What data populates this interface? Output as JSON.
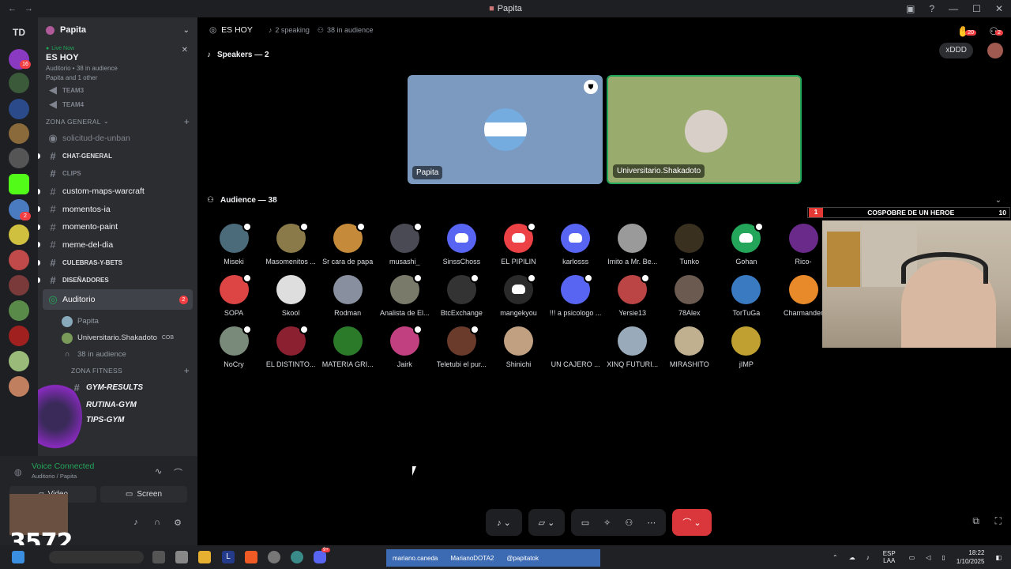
{
  "window": {
    "title": "Papita",
    "nav_back": "←",
    "nav_fwd": "→"
  },
  "servers": {
    "top_label": "TD",
    "badges": [
      "16",
      "2"
    ]
  },
  "guild": {
    "name": "Papita",
    "live": {
      "tag": "Live Now",
      "stage_name": "ES HOY",
      "meta": "Auditorio • 38 in audience",
      "people": "Papita and 1 other"
    },
    "channels_top": [
      "TEAM3",
      "TEAM4"
    ],
    "category_general": "ZONA GENERAL",
    "channels": [
      {
        "label": "solicitud-de-unban",
        "style": "muted"
      },
      {
        "label": "CHAT-GENERAL",
        "style": "small"
      },
      {
        "label": "CLIPS",
        "style": "small-muted"
      },
      {
        "label": "custom-maps-warcraft",
        "style": "normal"
      },
      {
        "label": "momentos-ia",
        "style": "normal"
      },
      {
        "label": "momento-paint",
        "style": "normal"
      },
      {
        "label": "meme-del-dia",
        "style": "normal"
      },
      {
        "label": "CULEBRAS-Y-BETS",
        "style": "small"
      },
      {
        "label": "DISEÑADORES",
        "style": "small"
      }
    ],
    "stage_channel": {
      "label": "Auditorio",
      "badge": "2"
    },
    "stage_users": [
      {
        "name": "Papita",
        "tag": ""
      },
      {
        "name": "Universitario.Shakadoto",
        "tag": "COB"
      }
    ],
    "stage_audience": "38 in audience",
    "category_fitness": "ZONA FITNESS",
    "fitness_channels": [
      "GYM-RESULTS",
      "RUTINA-GYM",
      "TIPS-GYM"
    ]
  },
  "user_panel": {
    "status": "Voice Connected",
    "location": "Auditorio / Papita",
    "video_label": "Video",
    "screen_label": "Screen",
    "viewer_count": "3572"
  },
  "stage": {
    "title": "ES HOY",
    "speaking": "2 speaking",
    "audience_count": "38 in audience",
    "hands_badge": "20",
    "invite_badge": "2",
    "xddd": "xDDD",
    "speakers_label": "Speakers — 2",
    "audience_label": "Audience — 38",
    "speakers": [
      {
        "name": "Papita",
        "color": "#7c9ac0"
      },
      {
        "name": "Universitario.Shakadoto",
        "color": "#9aab6e"
      }
    ],
    "audience": [
      {
        "name": "Miseki",
        "color": "#4b6b7a"
      },
      {
        "name": "Masomenitos ...",
        "color": "#8a7a4a"
      },
      {
        "name": "Sr cara de papa",
        "color": "#c58b3a"
      },
      {
        "name": "musashi_",
        "color": "#4a4a55"
      },
      {
        "name": "SinssChoss",
        "color": "#5865f2"
      },
      {
        "name": "EL PIPILIN",
        "color": "#ed4245"
      },
      {
        "name": "karlosss",
        "color": "#5865f2"
      },
      {
        "name": "Imito a Mr. Be...",
        "color": "#9a9a9a"
      },
      {
        "name": "Tunko",
        "color": "#3a3020"
      },
      {
        "name": "Gohan",
        "color": "#23a55a"
      },
      {
        "name": "Rico-",
        "color": "#6a2a8a"
      },
      {
        "name": "SOPA",
        "color": "#d44"
      },
      {
        "name": "Skool",
        "color": "#dedede"
      },
      {
        "name": "Rodman",
        "color": "#8890a0"
      },
      {
        "name": "Analista de El...",
        "color": "#7a7a6a"
      },
      {
        "name": "BtcExchange",
        "color": "#333"
      },
      {
        "name": "mangekyou",
        "color": "#2a2a2a"
      },
      {
        "name": "!!! a psicologo ...",
        "color": "#5865f2"
      },
      {
        "name": "Yersie13",
        "color": "#b44"
      },
      {
        "name": "78Alex",
        "color": "#6a5a50"
      },
      {
        "name": "TorTuGa",
        "color": "#3a7ac0"
      },
      {
        "name": "Charmander",
        "color": "#e88a2a"
      },
      {
        "name": "NoCry",
        "color": "#7a8a7a"
      },
      {
        "name": "EL DISTINTO...",
        "color": "#8a2030"
      },
      {
        "name": "MATERIA GRI...",
        "color": "#2a7a2a"
      },
      {
        "name": "Jairk",
        "color": "#c04080"
      },
      {
        "name": "Teletubi el pur...",
        "color": "#6a3a2a"
      },
      {
        "name": "Shinichi",
        "color": "#c0a080"
      },
      {
        "name": "UN CAJERO ...",
        "color": "#000"
      },
      {
        "name": "XINQ FUTURI...",
        "color": "#9ab"
      },
      {
        "name": "MIRASHITO",
        "color": "#c0b090"
      },
      {
        "name": "jIMP",
        "color": "#c0a030"
      }
    ]
  },
  "overlay": {
    "left_num": "1",
    "title": "COSPOBRE DE UN HEROE",
    "right_num": "10"
  },
  "taskbar": {
    "ticker": [
      "mariano.caneda",
      "MarianoDOTA2",
      "@papitatok"
    ],
    "lang": "ESP LAA",
    "time": "18:22",
    "date": "1/10/2025",
    "discord_badge": "9+"
  }
}
